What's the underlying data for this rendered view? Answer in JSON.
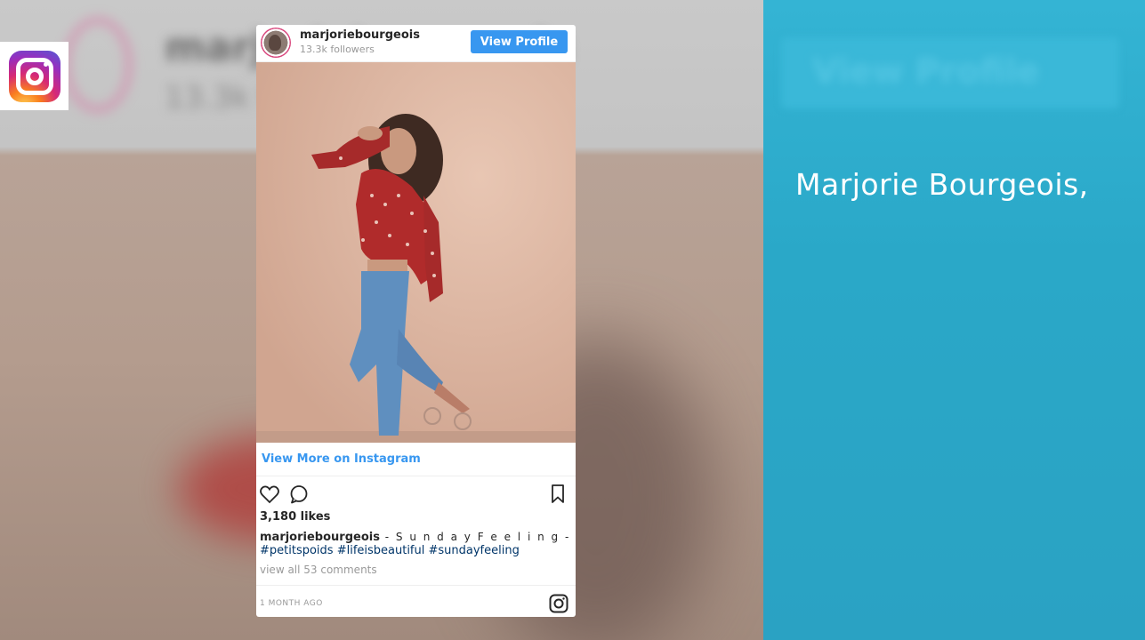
{
  "post": {
    "username": "marjoriebourgeois",
    "followers": "13.3k followers",
    "view_profile_label": "View Profile",
    "view_more_label": "View More on Instagram",
    "likes": "3,180 likes",
    "caption_user": "marjoriebourgeois",
    "caption_text": " - S u n d a y F e e l i n g -",
    "hashtags": "#petitspoids #lifeisbeautiful #sundayfeeling",
    "comments_link": "view all 53 comments",
    "timestamp": "1 MONTH AGO"
  },
  "panel": {
    "title": "Marjorie Bourgeois,"
  },
  "icons": {
    "logo": "instagram-icon",
    "heart": "heart-icon",
    "comment": "comment-icon",
    "bookmark": "bookmark-icon"
  },
  "colors": {
    "panel": "#2aa8c8",
    "link": "#3897f0",
    "hashtag": "#003569"
  }
}
